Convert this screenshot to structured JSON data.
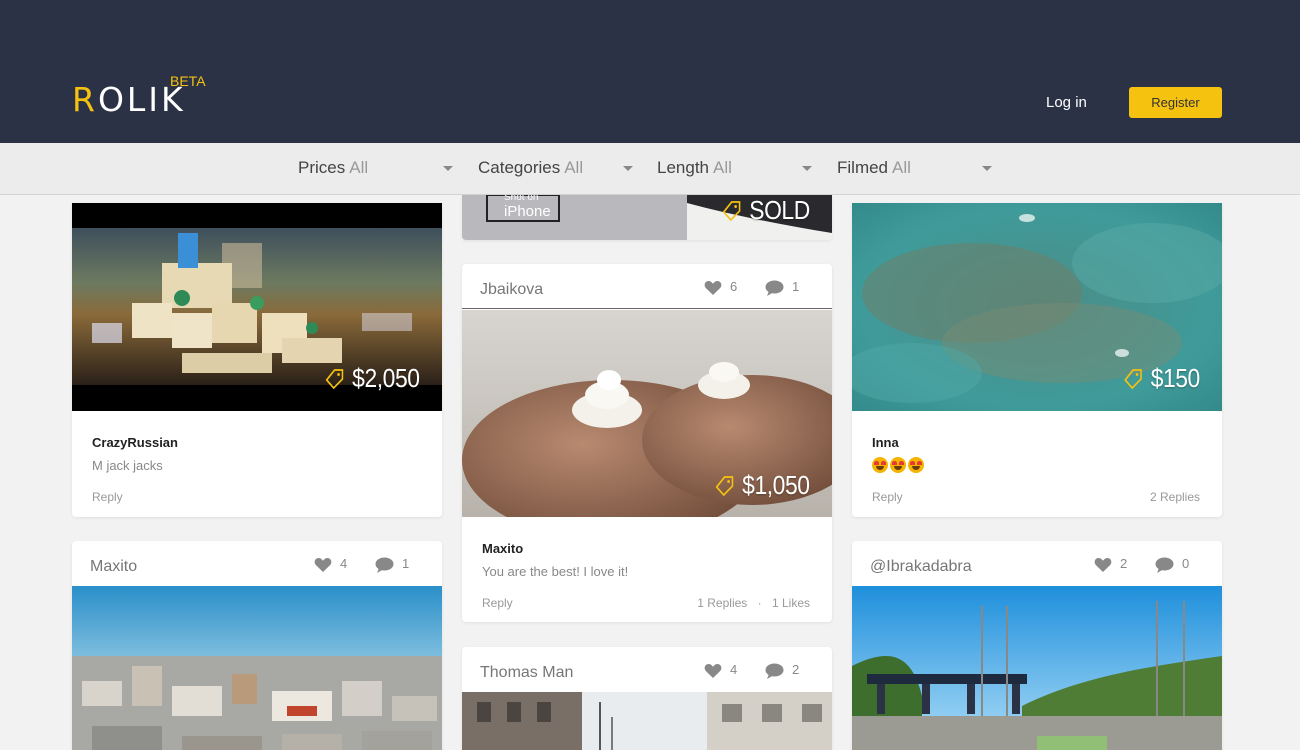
{
  "header": {
    "logo_first": "R",
    "logo_rest": "OLIK",
    "beta": "BETA",
    "login": "Log in",
    "register": "Register"
  },
  "filters": [
    {
      "label": "Prices",
      "value": "All"
    },
    {
      "label": "Categories",
      "value": "All"
    },
    {
      "label": "Length",
      "value": "All"
    },
    {
      "label": "Filmed",
      "value": "All"
    }
  ],
  "cards": {
    "crazyrussian": {
      "price": "$2,050",
      "comment_user": "CrazyRussian",
      "comment_text": "M jack jacks",
      "reply": "Reply"
    },
    "sold": {
      "price": "SOLD",
      "watermark_top": "Shot on",
      "watermark_bottom": "iPhone"
    },
    "jbaikova": {
      "user": "Jbaikova",
      "likes": "6",
      "comments": "1",
      "price": "$1,050",
      "comment_user": "Maxito",
      "comment_text": "You are the best! I love it!",
      "reply": "Reply",
      "replies": "1 Replies",
      "likes_label": "1 Likes",
      "dot": "·"
    },
    "inna": {
      "price": "$150",
      "comment_user": "Inna",
      "reply": "Reply",
      "replies": "2 Replies"
    },
    "maxito": {
      "user": "Maxito",
      "likes": "4",
      "comments": "1"
    },
    "thomas": {
      "user": "Thomas Man",
      "likes": "4",
      "comments": "2"
    },
    "ibrakadabra": {
      "user": "@Ibrakadabra",
      "likes": "2",
      "comments": "0"
    }
  },
  "colors": {
    "header_bg": "#2b3245",
    "accent": "#f5c210",
    "page_bg": "#f2f2f2"
  }
}
